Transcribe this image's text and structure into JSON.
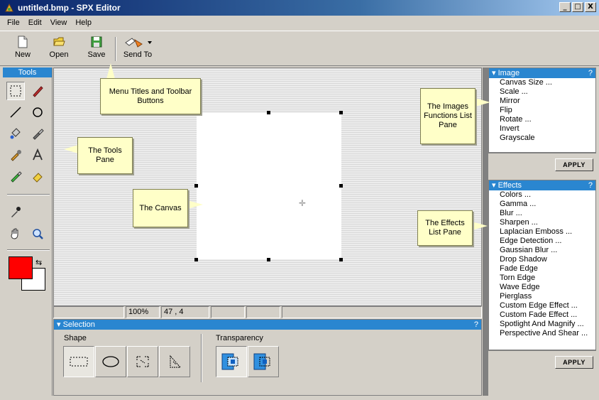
{
  "window": {
    "title": "untitled.bmp - SPX Editor",
    "min": "_",
    "max": "□",
    "close": "X"
  },
  "menu": [
    "File",
    "Edit",
    "View",
    "Help"
  ],
  "toolbar": {
    "new": "New",
    "open": "Open",
    "save": "Save",
    "send_to": "Send To"
  },
  "tools": {
    "title": "Tools"
  },
  "status": {
    "zoom": "100%",
    "coords": "47 , 4"
  },
  "selection": {
    "title": "Selection",
    "help": "?",
    "shape_label": "Shape",
    "transparency_label": "Transparency"
  },
  "image_pane": {
    "title": "Image",
    "help": "?",
    "items": [
      "Canvas Size ...",
      "Scale ...",
      "Mirror",
      "Flip",
      "Rotate ...",
      "Invert",
      "Grayscale"
    ],
    "apply": "APPLY"
  },
  "effects_pane": {
    "title": "Effects",
    "help": "?",
    "items": [
      "Colors ...",
      "Gamma ...",
      "Blur ...",
      "Sharpen ...",
      "Laplacian Emboss ...",
      "Edge Detection ...",
      "Gaussian Blur ...",
      "Drop Shadow",
      "Fade Edge",
      "Torn Edge",
      "Wave Edge",
      "Pierglass",
      "Custom Edge Effect ...",
      "Custom Fade Effect ...",
      "Spotlight And Magnify ...",
      "Perspective And Shear ..."
    ],
    "apply": "APPLY"
  },
  "callouts": {
    "menu": "Menu Titles and Toolbar Buttons",
    "tools": "The Tools Pane",
    "canvas": "The Canvas",
    "images": "The Images Functions List Pane",
    "effects": "The Effects List Pane"
  },
  "colors": {
    "accent": "#2a86d0",
    "foreground_color": "#ff0000",
    "background_color": "#ffffff",
    "callout": "#ffffc8"
  }
}
